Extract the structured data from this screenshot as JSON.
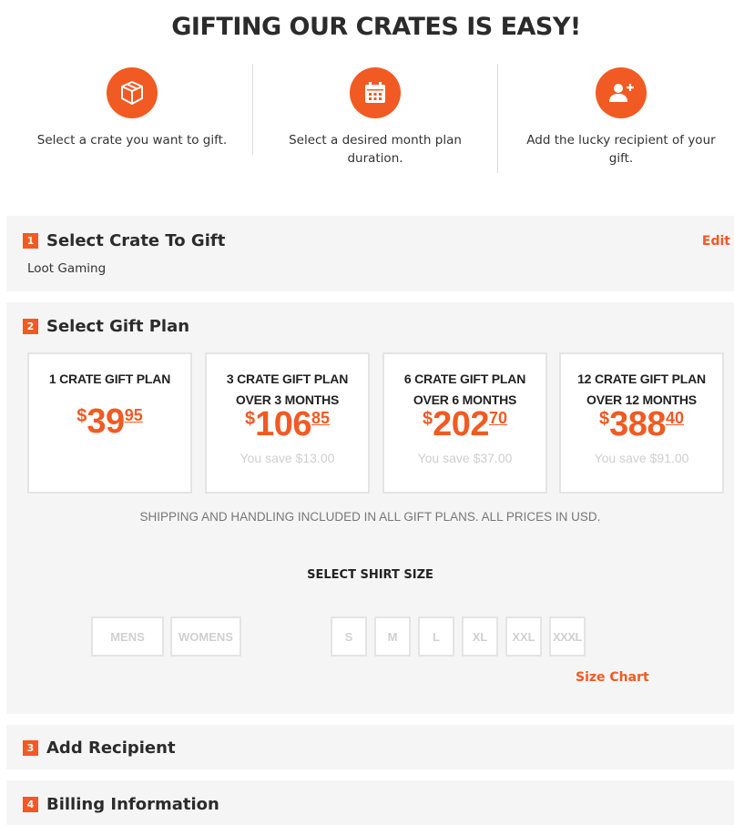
{
  "headline": "GIFTING OUR CRATES IS EASY!",
  "steps": [
    {
      "icon": "box-icon",
      "text_line1": "Select a crate you want to gift.",
      "text_line2": ""
    },
    {
      "icon": "calendar-icon",
      "text_line1": "Select a desired month plan",
      "text_line2": "duration."
    },
    {
      "icon": "add-user-icon",
      "text_line1": "Add the lucky recipient of your",
      "text_line2": "gift."
    }
  ],
  "section1": {
    "number": "1",
    "title": "Select Crate To Gift",
    "edit": "Edit",
    "selected": "Loot Gaming"
  },
  "section2": {
    "number": "2",
    "title": "Select Gift Plan",
    "plans": [
      {
        "name": "1 CRATE GIFT PLAN",
        "duration": "",
        "currency": "$",
        "dollars": "39",
        "cents": "95",
        "save": ""
      },
      {
        "name": "3 CRATE GIFT PLAN",
        "duration": "OVER 3 MONTHS",
        "currency": "$",
        "dollars": "106",
        "cents": "85",
        "save": "You save $13.00"
      },
      {
        "name": "6 CRATE GIFT PLAN",
        "duration": "OVER 6 MONTHS",
        "currency": "$",
        "dollars": "202",
        "cents": "70",
        "save": "You save $37.00"
      },
      {
        "name": "12 CRATE GIFT PLAN",
        "duration": "OVER 12 MONTHS",
        "currency": "$",
        "dollars": "388",
        "cents": "40",
        "save": "You save $91.00"
      }
    ],
    "shipping_note": "SHIPPING AND HANDLING INCLUDED IN ALL GIFT PLANS. ALL PRICES IN USD.",
    "shirt_title": "SELECT SHIRT SIZE",
    "genders": [
      "MENS",
      "WOMENS"
    ],
    "sizes": [
      "S",
      "M",
      "L",
      "XL",
      "XXL",
      "XXXL"
    ],
    "size_chart": "Size Chart"
  },
  "section3": {
    "number": "3",
    "title": "Add Recipient"
  },
  "section4": {
    "number": "4",
    "title": "Billing Information"
  },
  "colors": {
    "accent": "#f15a22",
    "panel": "#f5f5f5",
    "border": "#e4e4e4",
    "muted": "#cfcfcf"
  }
}
